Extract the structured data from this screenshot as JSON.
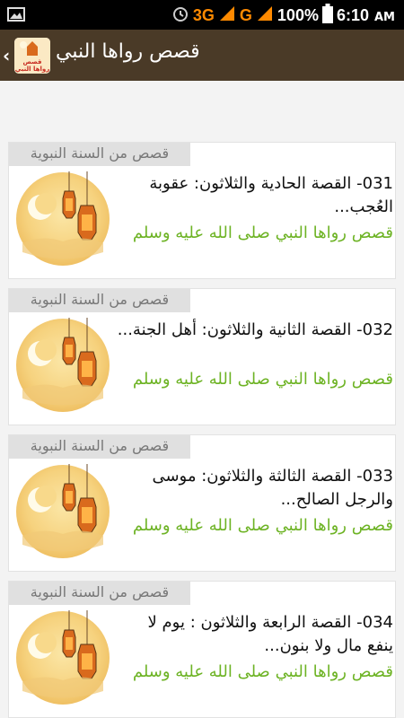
{
  "status_bar": {
    "network_3g": "3G",
    "network_g": "G",
    "battery": "100%",
    "time": "6:10",
    "ampm": "AM",
    "icons": [
      "gallery-icon",
      "alarm-icon",
      "signal-icon",
      "battery-icon"
    ]
  },
  "action_bar": {
    "title": "قصص رواها النبي",
    "logo_text": "قصص رواها النبي"
  },
  "stories": [
    {
      "tag": "قصص من السنة النبوية",
      "title": "031- القصة الحادية والثلاثون: عقوبة العُجب...",
      "subtitle": "قصص رواها النبي صلى الله عليه وسلم"
    },
    {
      "tag": "قصص من السنة النبوية",
      "title": "032- القصة الثانية والثلاثون: أهل الجنة...",
      "subtitle": "قصص رواها النبي صلى الله عليه وسلم"
    },
    {
      "tag": "قصص من السنة النبوية",
      "title": "033- القصة الثالثة والثلاثون: موسى والرجل الصالح...",
      "subtitle": "قصص رواها النبي صلى الله عليه وسلم"
    },
    {
      "tag": "قصص من السنة النبوية",
      "title": "034- القصة الرابعة والثلاثون : يوم لا ينفع مال ولا بنون...",
      "subtitle": "قصص رواها النبي صلى الله عليه وسلم"
    }
  ],
  "colors": {
    "action_bar": "#4a3a27",
    "subtitle_green": "#6db324",
    "status_orange": "#ff8a00"
  }
}
